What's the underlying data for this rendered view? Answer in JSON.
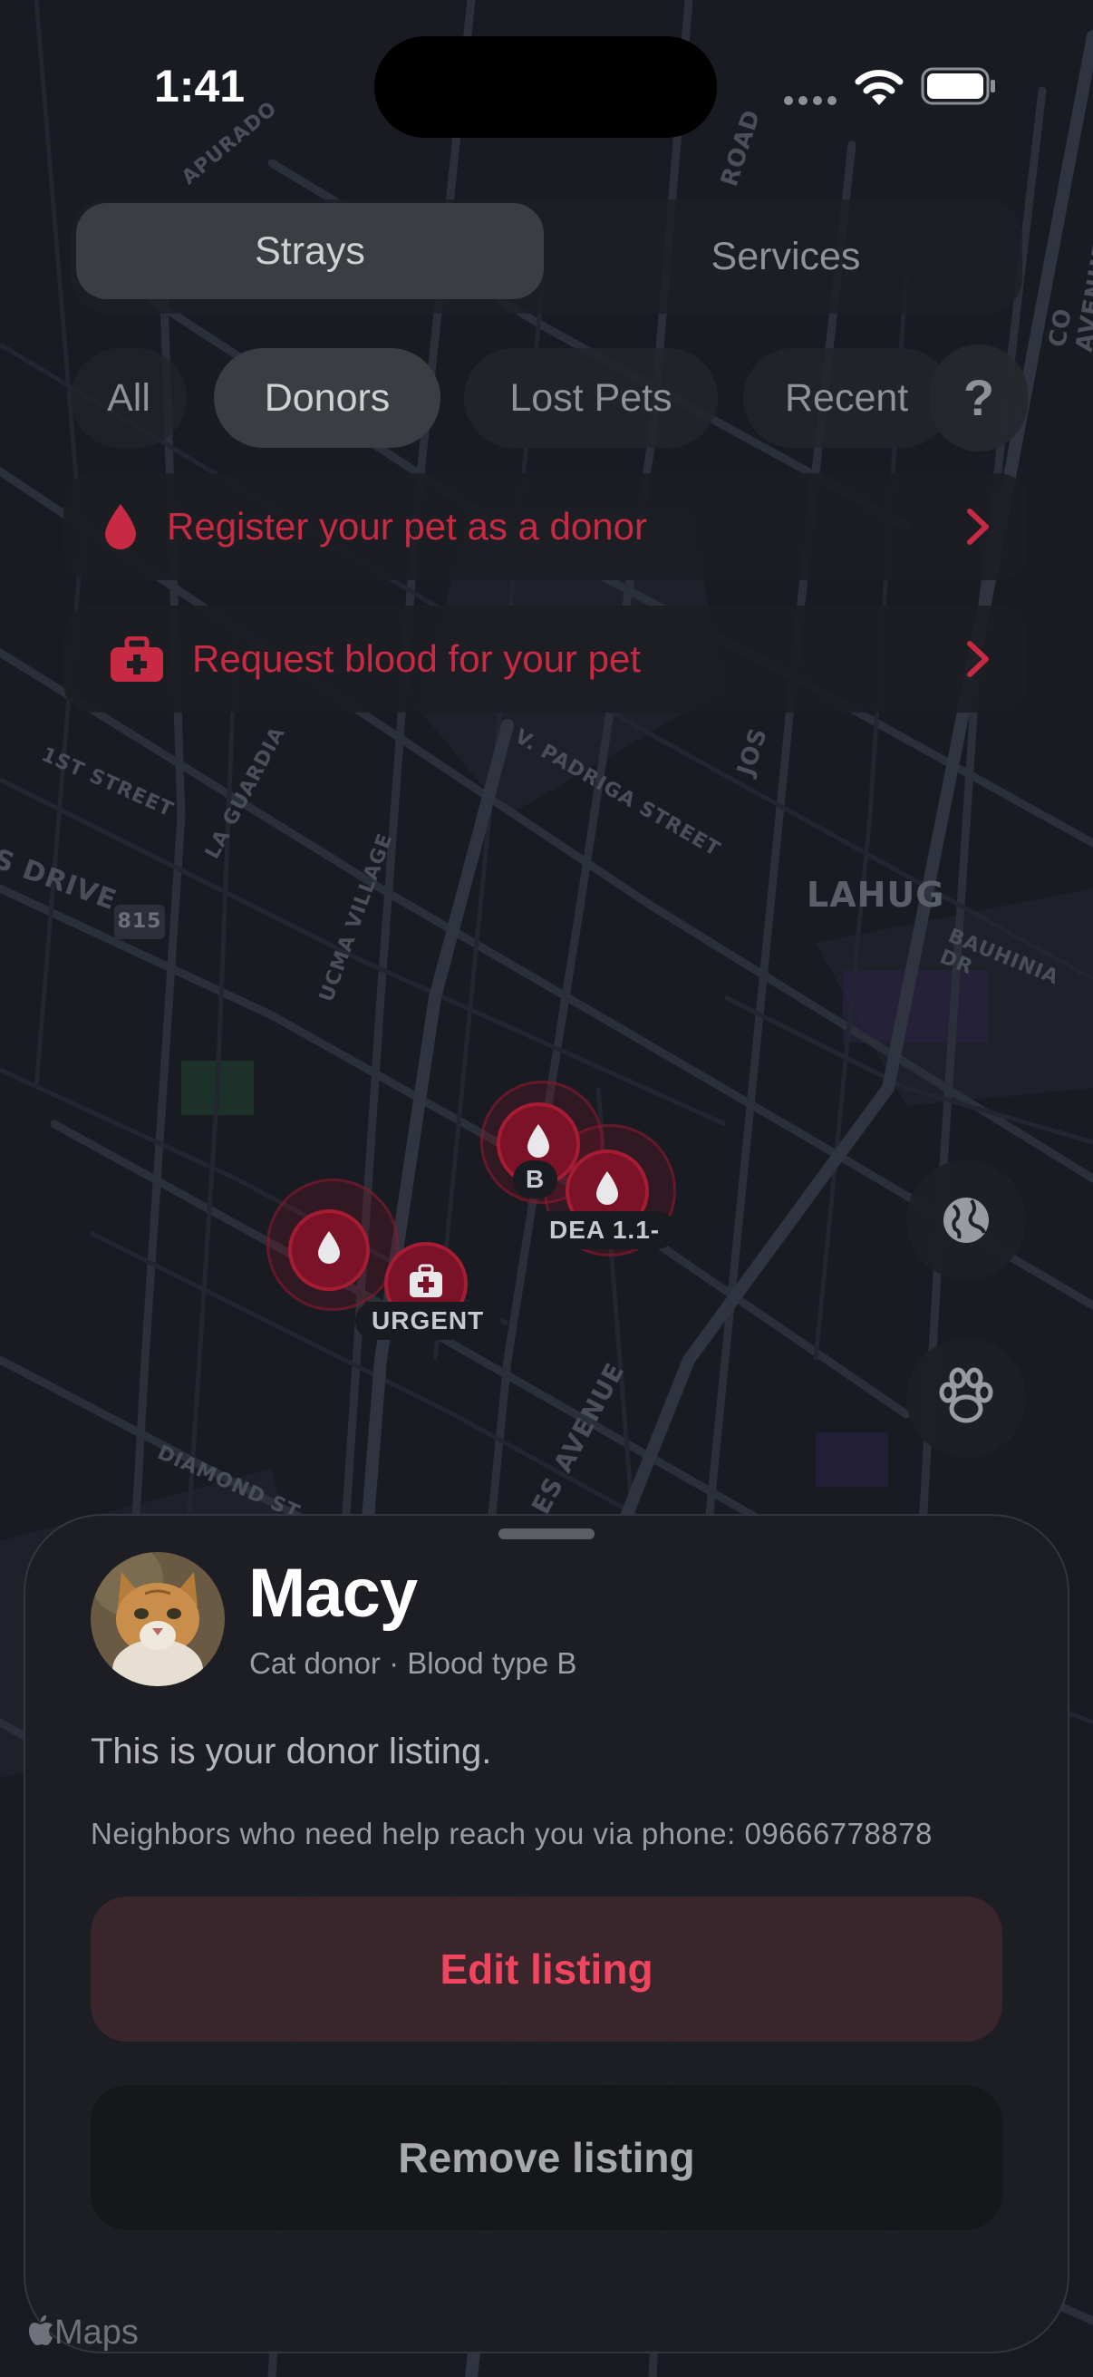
{
  "status_bar": {
    "time": "1:41"
  },
  "segments": {
    "strays": "Strays",
    "services": "Services"
  },
  "filters": {
    "all": "All",
    "donors": "Donors",
    "lost_pets": "Lost Pets",
    "recent": "Recent",
    "help": "?"
  },
  "banners": {
    "register": "Register your pet as a donor",
    "request": "Request blood for your pet"
  },
  "map": {
    "labels": {
      "lahug": "LAHUG",
      "route": "815",
      "street1": "1ST STREET",
      "street2": "V. PADRIGA STREET",
      "street3": "LA GUARDIA",
      "street4": "UCMA VILLAGE",
      "street5": "S DRIVE",
      "street6": "BAUHINIA DR",
      "street7": "DIAMOND ST",
      "street8": "ES AVENUE",
      "street9": "APURADO",
      "street10": "ROAD",
      "street11": "CO AVENUE",
      "street12": "JOS"
    },
    "markers": {
      "tag_b": "B",
      "tag_dea": "DEA 1.1-",
      "tag_urgent": "URGENT"
    }
  },
  "sheet": {
    "pet_name": "Macy",
    "pet_subtitle": "Cat donor · Blood type B",
    "listing_message": "This is your donor listing.",
    "contact_message": "Neighbors who need help reach you via phone: 09666778878",
    "edit_label": "Edit listing",
    "remove_label": "Remove listing"
  },
  "attribution": {
    "maps": "Maps"
  },
  "colors": {
    "accent": "#f0455f",
    "banner_red": "#c72a42",
    "marker_red": "#7c1227"
  }
}
